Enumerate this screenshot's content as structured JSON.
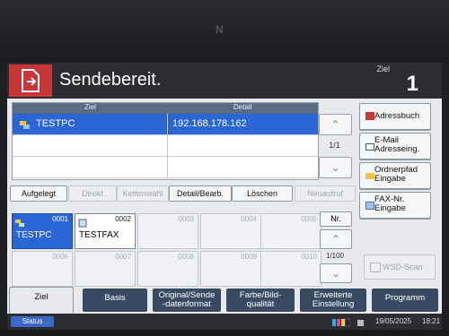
{
  "header": {
    "title": "Sendebereit.",
    "destination_label": "Ziel",
    "destination_count": "1"
  },
  "table": {
    "col_name": "Ziel",
    "col_detail": "Detail",
    "rows": [
      {
        "name": "TESTPC",
        "detail": "192.168.178.162",
        "selected": true
      },
      {
        "name": "",
        "detail": "",
        "selected": false
      },
      {
        "name": "",
        "detail": "",
        "selected": false
      }
    ],
    "page": "1/1"
  },
  "side": {
    "address_book": "Adressbuch",
    "email_line1": "E-Mail",
    "email_line2": "Adresseing.",
    "folder_line1": "Ordnerpfad",
    "folder_line2": "Eingabe",
    "fax_line1": "FAX-Nr.",
    "fax_line2": "Eingabe"
  },
  "actions": {
    "on_hook": "Aufgelegt",
    "direct": "Direkt",
    "chain": "Kettenwahl",
    "detail_edit": "Detail/Bearb.",
    "delete": "Löschen",
    "redial": "Neuaufruf"
  },
  "onetouch": {
    "keys": [
      {
        "num": "0001",
        "name": "TESTPC"
      },
      {
        "num": "0002",
        "name": "TESTFAX"
      },
      {
        "num": "0003",
        "name": ""
      },
      {
        "num": "0004",
        "name": ""
      },
      {
        "num": "0005",
        "name": ""
      },
      {
        "num": "0006",
        "name": ""
      },
      {
        "num": "0007",
        "name": ""
      },
      {
        "num": "0008",
        "name": ""
      },
      {
        "num": "0009",
        "name": ""
      },
      {
        "num": "0010",
        "name": ""
      }
    ],
    "nr_label": "Nr.",
    "page": "1/100",
    "wsd_scan": "WSD-Scan"
  },
  "tabs": {
    "dest": "Ziel",
    "basic": "Basis",
    "orig_line1": "Original/Sende",
    "orig_line2": "-datenformat",
    "color_line1": "Farbe/Bild-",
    "color_line2": "qualität",
    "adv_line1": "Erweiterte",
    "adv_line2": "Einstellung",
    "program": "Programm"
  },
  "status": {
    "button": "Status",
    "date": "19/05/2025",
    "time": "18:21"
  },
  "colors": {
    "accent": "#2b66d6",
    "header": "#2c2d31",
    "send_icon": "#c8363a",
    "tab": "#3a4a63"
  }
}
